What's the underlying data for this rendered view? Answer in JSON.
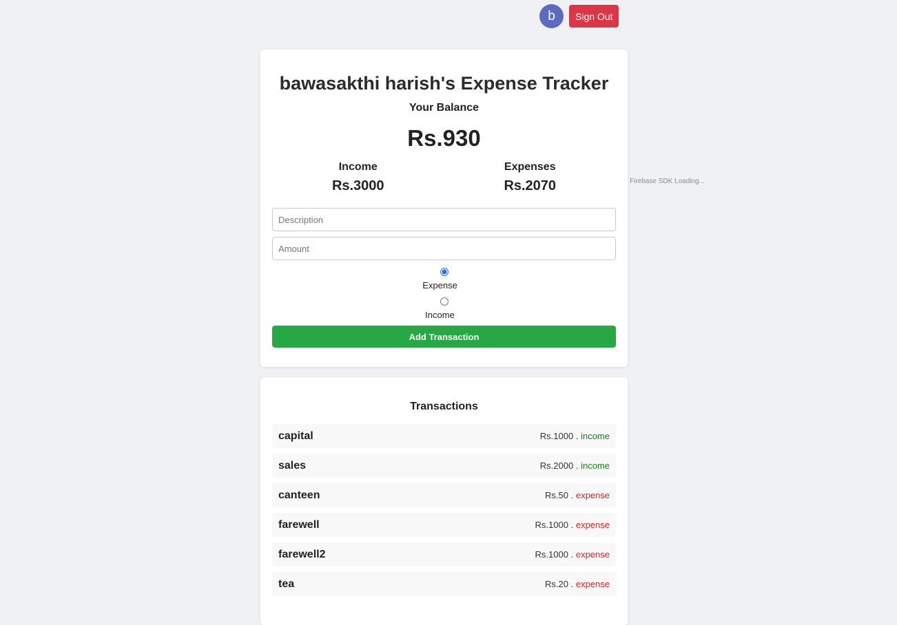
{
  "header": {
    "avatar_initial": "b",
    "signout_label": "Sign Out"
  },
  "tracker": {
    "title": "bawasakthi harish's Expense Tracker",
    "balance_label": "Your Balance",
    "balance_value": "Rs.930",
    "income_label": "Income",
    "income_value": "Rs.3000",
    "expenses_label": "Expenses",
    "expenses_value": "Rs.2070"
  },
  "form": {
    "description_placeholder": "Description",
    "amount_placeholder": "Amount",
    "expense_label": "Expense",
    "income_label": "Income",
    "selected_type": "expense",
    "add_label": "Add Transaction"
  },
  "transactions": {
    "title": "Transactions",
    "items": [
      {
        "name": "capital",
        "amount": "Rs.1000",
        "sep": ".",
        "type": "income"
      },
      {
        "name": "sales",
        "amount": "Rs.2000",
        "sep": ".",
        "type": "income"
      },
      {
        "name": "canteen",
        "amount": "Rs.50",
        "sep": ".",
        "type": "expense"
      },
      {
        "name": "farewell",
        "amount": "Rs.1000",
        "sep": ".",
        "type": "expense"
      },
      {
        "name": "farewell2",
        "amount": "Rs.1000",
        "sep": ".",
        "type": "expense"
      },
      {
        "name": "tea",
        "amount": "Rs.20",
        "sep": ".",
        "type": "expense"
      }
    ]
  },
  "status": {
    "sdk_text": "Firebase SDK Loading..."
  },
  "colors": {
    "signout": "#dc3545",
    "add_button": "#28a745",
    "avatar": "#5c6bc0",
    "income_text": "#1a7f1a",
    "expense_text": "#e01e1e"
  }
}
